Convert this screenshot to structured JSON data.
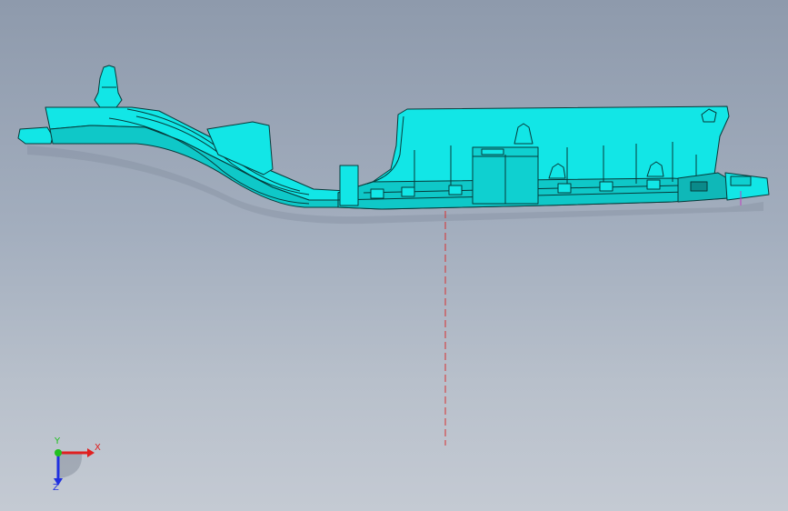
{
  "viewport": {
    "background_top": "#8e9aac",
    "background_bottom": "#c4cad3"
  },
  "part": {
    "fill_color": "#12e6e6",
    "shadow_color": "#0fb8b8",
    "edge_color": "#063a3a"
  },
  "centerline": {
    "color": "#d83030"
  },
  "triad": {
    "x_label": "X",
    "y_label": "Y",
    "z_label": "Z",
    "x_color": "#e02020",
    "y_color": "#20c020",
    "z_color": "#2030e0"
  }
}
